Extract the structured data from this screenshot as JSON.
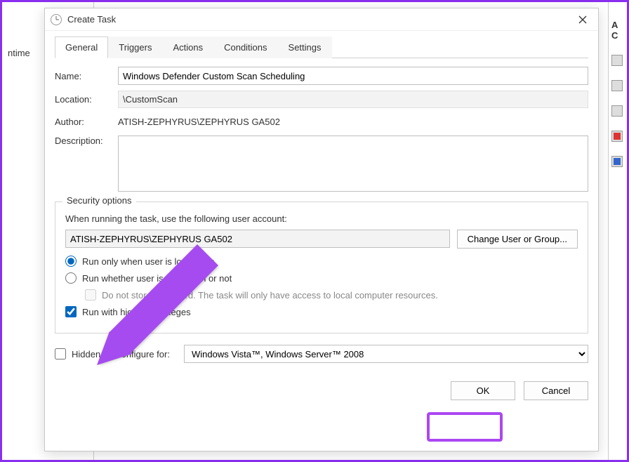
{
  "window": {
    "title": "Create Task",
    "tabs": [
      "General",
      "Triggers",
      "Actions",
      "Conditions",
      "Settings"
    ],
    "active_tab": "General"
  },
  "general": {
    "labels": {
      "name": "Name:",
      "location": "Location:",
      "author": "Author:",
      "description": "Description:"
    },
    "name": "Windows Defender Custom Scan Scheduling",
    "location": "\\CustomScan",
    "author": "ATISH-ZEPHYRUS\\ZEPHYRUS GA502",
    "description": ""
  },
  "security": {
    "group_title": "Security options",
    "when_running_label": "When running the task, use the following user account:",
    "account": "ATISH-ZEPHYRUS\\ZEPHYRUS GA502",
    "change_user_btn": "Change User or Group...",
    "radio_logged_on": "Run only when user is logged on",
    "radio_logged_or_not": "Run whether user is logged on or not",
    "store_password": "Do not store password.  The task will only have access to local computer resources.",
    "run_highest": "Run with highest privileges",
    "radio_selected": "logged_on",
    "run_highest_checked": true,
    "store_password_checked": false
  },
  "bottom": {
    "hidden_label": "Hidden",
    "hidden_checked": false,
    "configure_label": "Configure for:",
    "configure_value": "Windows Vista™, Windows Server™ 2008"
  },
  "footer": {
    "ok": "OK",
    "cancel": "Cancel"
  },
  "backdrop": {
    "ntime": "ntime",
    "right_label_a": "A",
    "right_label_c": "C"
  }
}
